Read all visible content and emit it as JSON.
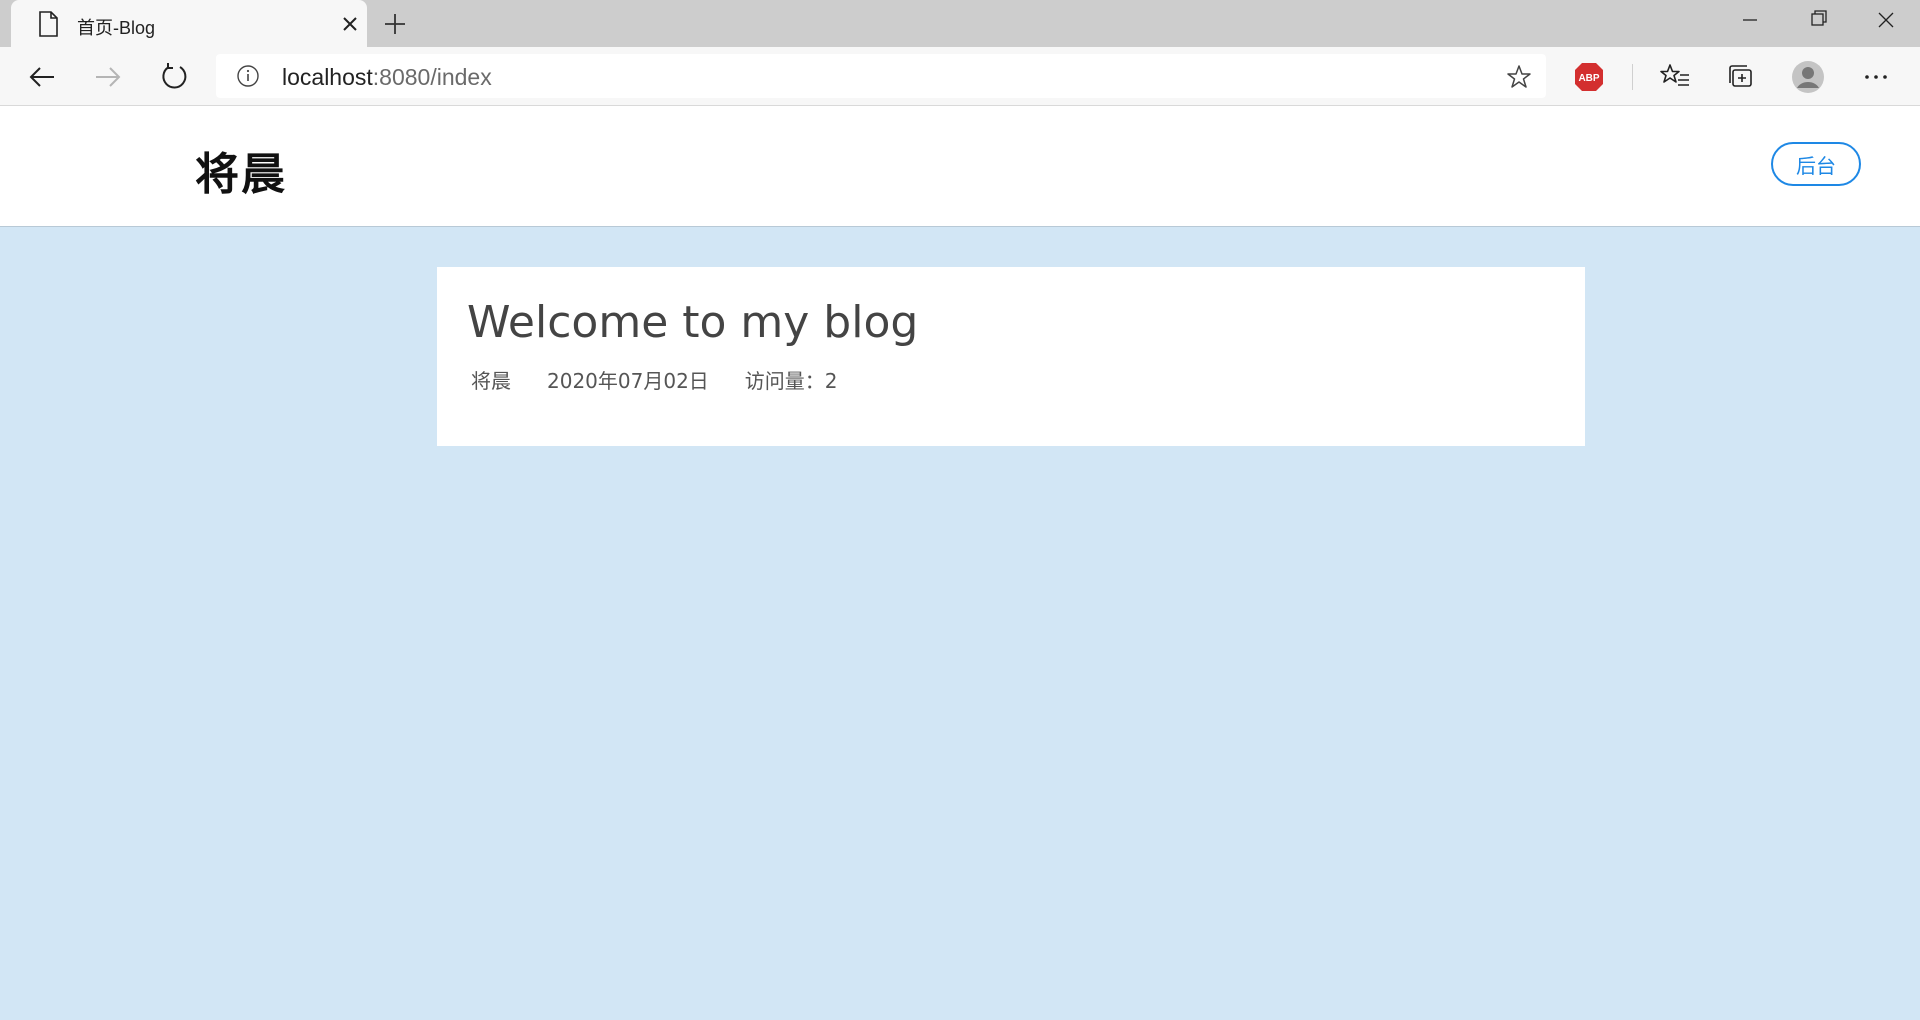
{
  "browser": {
    "tab_title": "首页-Blog",
    "url_host": "localhost",
    "url_path": ":8080/index"
  },
  "site": {
    "logo": "将晨",
    "admin_button": "后台"
  },
  "post": {
    "title": "Welcome to my blog",
    "author": "将晨",
    "date": "2020年07月02日",
    "views": "访问量：2"
  },
  "colors": {
    "page_background": "#d2e6f5",
    "accent": "#1e88e5",
    "adblock_red": "#d32f2f"
  }
}
